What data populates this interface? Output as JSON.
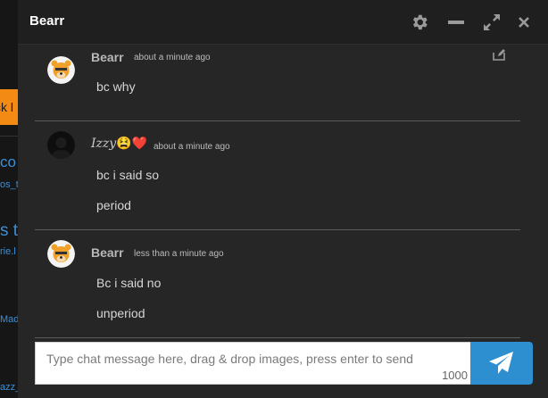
{
  "background": {
    "button_fragment": "ck l",
    "link_a": "co",
    "link_b": "os_t",
    "link_c": "s t",
    "link_d": "rie.l",
    "link_e": "Mad",
    "link_f": "azz_"
  },
  "window": {
    "title": "Bearr",
    "controls": [
      "gear-icon",
      "minimize-icon",
      "expand-icon",
      "close-icon"
    ]
  },
  "messages": [
    {
      "user": "Bearr",
      "time": "about a minute ago",
      "lines": [
        "bc why"
      ],
      "avatar": "bear-avatar"
    },
    {
      "user": "Izzy",
      "emoji": "😫❤️",
      "time": "about a minute ago",
      "lines": [
        "bc i said so",
        "period"
      ],
      "avatar": "dark-avatar"
    },
    {
      "user": "Bearr",
      "time": "less than a minute ago",
      "lines": [
        "Bc i said no",
        "unperiod"
      ],
      "avatar": "bear-avatar"
    }
  ],
  "composer": {
    "placeholder": "Type chat message here, drag & drop images, press enter to send",
    "value": "",
    "char_count": "1000"
  },
  "colors": {
    "accent": "#2e8fd0",
    "window_bg": "#262626",
    "header_bg": "#1f1f1f",
    "orange": "#f28a13"
  }
}
